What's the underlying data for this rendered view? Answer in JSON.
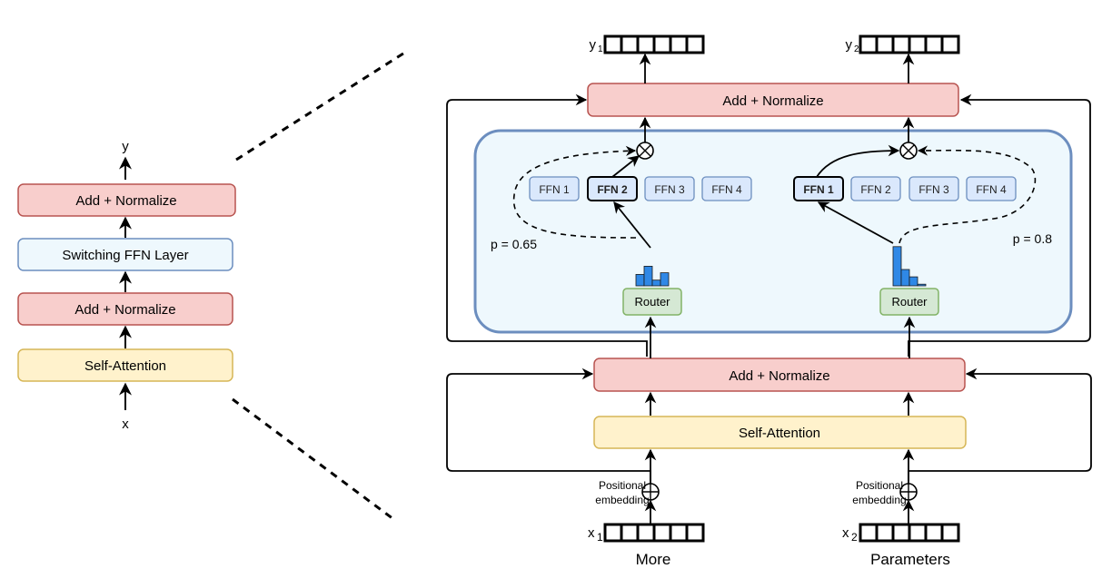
{
  "colors": {
    "addnorm_fill": "#f8cecc",
    "addnorm_stroke": "#b85450",
    "ffnlayer_fill": "#eef8fd",
    "ffnlayer_stroke": "#6c8ebf",
    "selfattn_fill": "#fff2cc",
    "selfattn_stroke": "#d6b656",
    "router_fill": "#d5e8d4",
    "router_stroke": "#82b366",
    "ffn_fill": "#dae8fc",
    "ffn_stroke": "#6c8ebf",
    "expanded_fill": "#eef8fd",
    "expanded_stroke": "#6c8ebf",
    "bar_fill": "#2f88e6"
  },
  "overview": {
    "output_label": "y",
    "input_label": "x",
    "blocks": [
      "Add + Normalize",
      "Switching FFN Layer",
      "Add + Normalize",
      "Self-Attention"
    ]
  },
  "detail": {
    "top_addnorm": "Add + Normalize",
    "mid_addnorm": "Add + Normalize",
    "self_attention": "Self-Attention",
    "tokens": [
      {
        "output_label": "y",
        "output_sub": "1",
        "input_label": "x",
        "input_sub": "1",
        "word": "More",
        "pos_embedding": [
          "Positional",
          "embedding"
        ],
        "router_label": "Router",
        "router_probs": [
          0.14,
          0.24,
          0.07,
          0.16
        ],
        "selected_expert": 2,
        "probability_label": "p = 0.65",
        "experts": [
          "FFN 1",
          "FFN 2",
          "FFN 3",
          "FFN 4"
        ]
      },
      {
        "output_label": "y",
        "output_sub": "2",
        "input_label": "x",
        "input_sub": "2",
        "word": "Parameters",
        "pos_embedding": [
          "Positional",
          "embedding"
        ],
        "router_label": "Router",
        "router_probs": [
          0.48,
          0.2,
          0.11,
          0.02
        ],
        "selected_expert": 1,
        "probability_label": "p = 0.8",
        "experts": [
          "FFN 1",
          "FFN 2",
          "FFN 3",
          "FFN 4"
        ]
      }
    ],
    "vector_cells": 6
  }
}
